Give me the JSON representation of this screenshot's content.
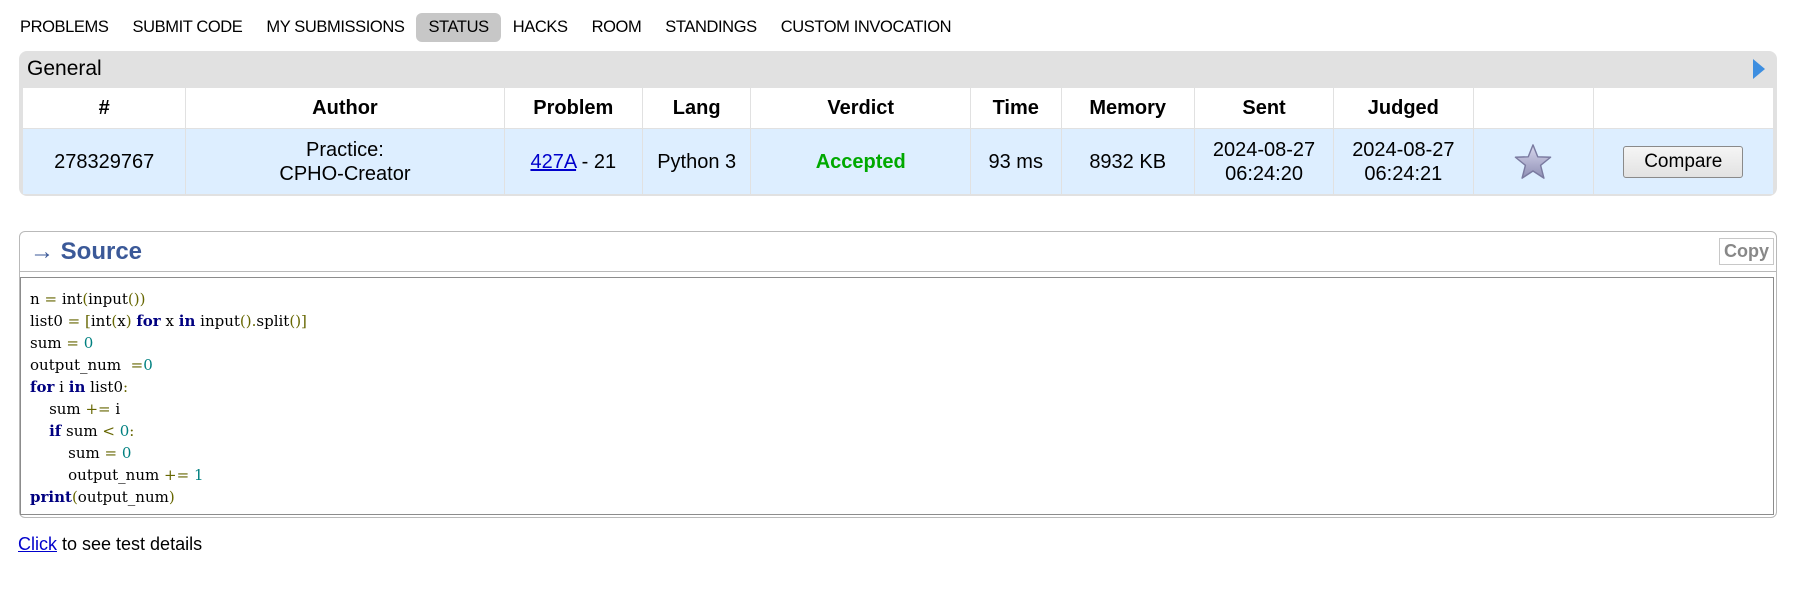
{
  "nav": {
    "items": [
      {
        "label": "PROBLEMS",
        "active": false
      },
      {
        "label": "SUBMIT CODE",
        "active": false
      },
      {
        "label": "MY SUBMISSIONS",
        "active": false
      },
      {
        "label": "STATUS",
        "active": true
      },
      {
        "label": "HACKS",
        "active": false
      },
      {
        "label": "ROOM",
        "active": false
      },
      {
        "label": "STANDINGS",
        "active": false
      },
      {
        "label": "CUSTOM INVOCATION",
        "active": false
      }
    ]
  },
  "status": {
    "title": "General",
    "columns": [
      "#",
      "Author",
      "Problem",
      "Lang",
      "Verdict",
      "Time",
      "Memory",
      "Sent",
      "Judged",
      "",
      ""
    ],
    "row": {
      "id": "278329767",
      "author_line1": "Practice:",
      "author_line2": "CPHO-Creator",
      "problem_link": "427A",
      "problem_suffix": " - 21",
      "lang": "Python 3",
      "verdict": "Accepted",
      "time": "93 ms",
      "memory": "8932 KB",
      "sent_date": "2024-08-27",
      "sent_time": "06:24:20",
      "judged_date": "2024-08-27",
      "judged_time": "06:24:21",
      "compare_label": "Compare"
    }
  },
  "source": {
    "title": "→ Source",
    "copy_label": "Copy",
    "code_lines": [
      "n = int(input())",
      "list0 = [int(x) for x in input().split()]",
      "sum = 0",
      "output_num  =0",
      "for i in list0:",
      "    sum += i",
      "    if sum < 0:",
      "        sum = 0",
      "        output_num += 1",
      "print(output_num)"
    ]
  },
  "footer": {
    "link_label": "Click",
    "text": " to see test details"
  },
  "colors": {
    "accent_link": "#0000cc",
    "verdict_accepted": "#00a900",
    "row_bg": "#ddeeff",
    "source_title": "#3b5998"
  }
}
